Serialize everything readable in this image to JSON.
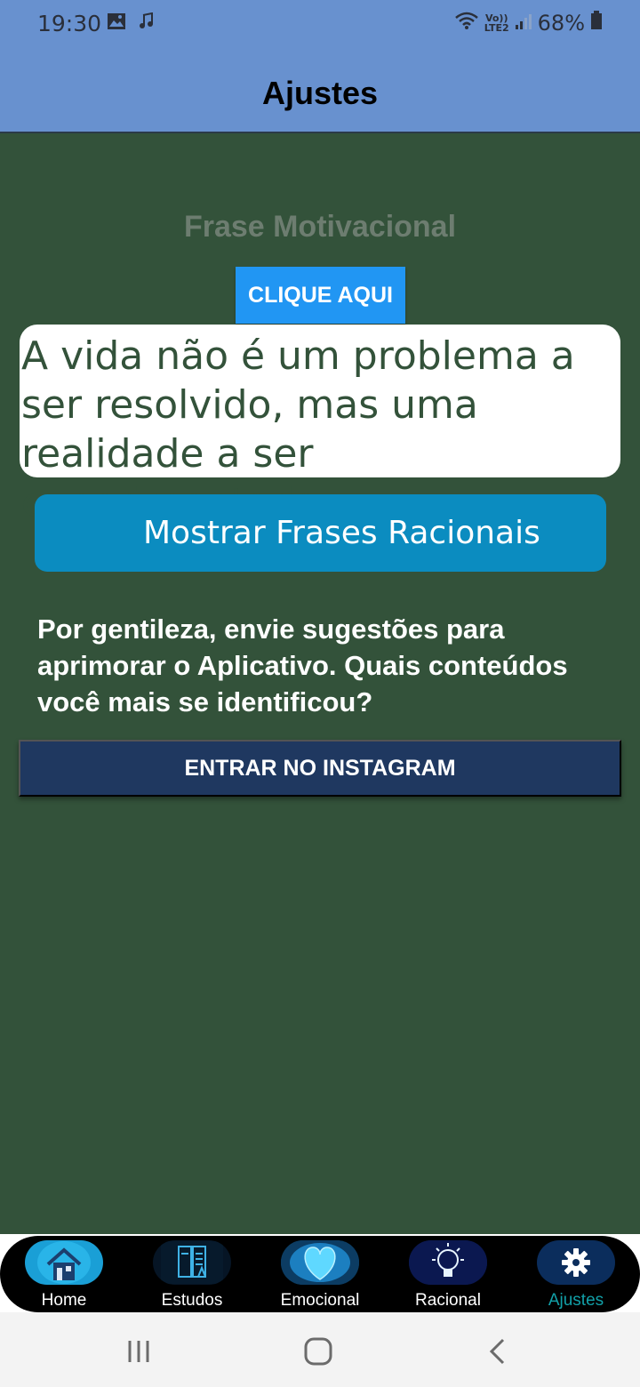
{
  "status_bar": {
    "time": "19:30",
    "battery": "68%",
    "network": "LTE2"
  },
  "app_bar": {
    "title": "Ajustes"
  },
  "content": {
    "subtitle": "Frase Motivacional",
    "click_button": "CLIQUE AQUI",
    "quote": "A vida não é um problema a ser resolvido, mas uma realidade a ser experimentada.",
    "rational_button": "Mostrar Frases Racionais",
    "suggestion_text": "Por gentileza, envie sugestões para aprimorar o Aplicativo. Quais conteúdos você mais se identificou?",
    "instagram_button": "ENTRAR NO INSTAGRAM"
  },
  "bottom_nav": {
    "items": [
      {
        "label": "Home",
        "icon": "house-icon"
      },
      {
        "label": "Estudos",
        "icon": "book-icon"
      },
      {
        "label": "Emocional",
        "icon": "heart-icon"
      },
      {
        "label": "Racional",
        "icon": "lightbulb-icon"
      },
      {
        "label": "Ajustes",
        "icon": "gear-icon",
        "active": true
      }
    ],
    "active_color": "#12a0a8"
  },
  "colors": {
    "app_bar": "#6891cf",
    "background": "#33523a",
    "click_button": "#2196f3",
    "rational_button": "#0b8cc0",
    "instagram_button": "#1f3860"
  }
}
